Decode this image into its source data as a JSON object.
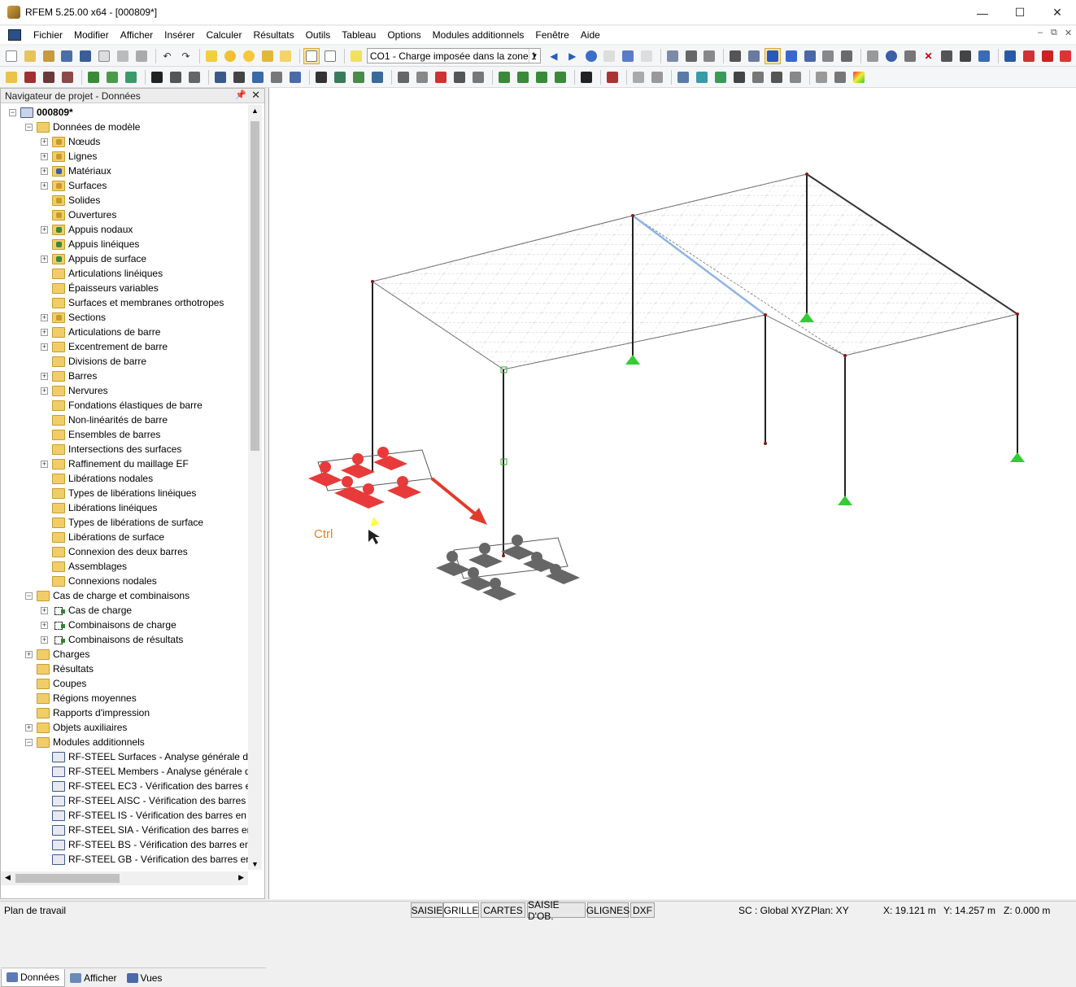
{
  "window": {
    "title": "RFEM 5.25.00 x64 - [000809*]"
  },
  "menu": [
    "Fichier",
    "Modifier",
    "Afficher",
    "Insérer",
    "Calculer",
    "Résultats",
    "Outils",
    "Tableau",
    "Options",
    "Modules additionnels",
    "Fenêtre",
    "Aide"
  ],
  "toolbar": {
    "load_case_combo": "CO1 - Charge imposée dans la zone 1"
  },
  "navigator": {
    "title": "Navigateur de projet - Données",
    "root": "000809*",
    "items": [
      {
        "label": "Données de modèle",
        "level": 1,
        "exp": "-",
        "icon": "folder"
      },
      {
        "label": "Nœuds",
        "level": 2,
        "exp": "+",
        "icon": "node"
      },
      {
        "label": "Lignes",
        "level": 2,
        "exp": "+",
        "icon": "line"
      },
      {
        "label": "Matériaux",
        "level": 2,
        "exp": "+",
        "icon": "mat"
      },
      {
        "label": "Surfaces",
        "level": 2,
        "exp": "+",
        "icon": "surf"
      },
      {
        "label": "Solides",
        "level": 2,
        "exp": "",
        "icon": "solid"
      },
      {
        "label": "Ouvertures",
        "level": 2,
        "exp": "",
        "icon": "open"
      },
      {
        "label": "Appuis nodaux",
        "level": 2,
        "exp": "+",
        "icon": "sup"
      },
      {
        "label": "Appuis linéiques",
        "level": 2,
        "exp": "",
        "icon": "sup"
      },
      {
        "label": "Appuis de surface",
        "level": 2,
        "exp": "+",
        "icon": "sup"
      },
      {
        "label": "Articulations linéiques",
        "level": 2,
        "exp": "",
        "icon": "folder"
      },
      {
        "label": "Épaisseurs variables",
        "level": 2,
        "exp": "",
        "icon": "folder"
      },
      {
        "label": "Surfaces et membranes orthotropes",
        "level": 2,
        "exp": "",
        "icon": "folder"
      },
      {
        "label": "Sections",
        "level": 2,
        "exp": "+",
        "icon": "sec"
      },
      {
        "label": "Articulations de barre",
        "level": 2,
        "exp": "+",
        "icon": "folder"
      },
      {
        "label": "Excentrement de barre",
        "level": 2,
        "exp": "+",
        "icon": "folder"
      },
      {
        "label": "Divisions de barre",
        "level": 2,
        "exp": "",
        "icon": "folder"
      },
      {
        "label": "Barres",
        "level": 2,
        "exp": "+",
        "icon": "folder"
      },
      {
        "label": "Nervures",
        "level": 2,
        "exp": "+",
        "icon": "folder"
      },
      {
        "label": "Fondations élastiques de barre",
        "level": 2,
        "exp": "",
        "icon": "folder"
      },
      {
        "label": "Non-linéarités de barre",
        "level": 2,
        "exp": "",
        "icon": "folder"
      },
      {
        "label": "Ensembles de barres",
        "level": 2,
        "exp": "",
        "icon": "folder"
      },
      {
        "label": "Intersections des surfaces",
        "level": 2,
        "exp": "",
        "icon": "folder"
      },
      {
        "label": "Raffinement du maillage EF",
        "level": 2,
        "exp": "+",
        "icon": "folder"
      },
      {
        "label": "Libérations nodales",
        "level": 2,
        "exp": "",
        "icon": "folder"
      },
      {
        "label": "Types de libérations linéiques",
        "level": 2,
        "exp": "",
        "icon": "folder"
      },
      {
        "label": "Libérations linéiques",
        "level": 2,
        "exp": "",
        "icon": "folder"
      },
      {
        "label": "Types de libérations de surface",
        "level": 2,
        "exp": "",
        "icon": "folder"
      },
      {
        "label": "Libérations de surface",
        "level": 2,
        "exp": "",
        "icon": "folder"
      },
      {
        "label": "Connexion des deux barres",
        "level": 2,
        "exp": "",
        "icon": "folder"
      },
      {
        "label": "Assemblages",
        "level": 2,
        "exp": "",
        "icon": "folder"
      },
      {
        "label": "Connexions nodales",
        "level": 2,
        "exp": "",
        "icon": "folder"
      },
      {
        "label": "Cas de charge et combinaisons",
        "level": 1,
        "exp": "-",
        "icon": "folder"
      },
      {
        "label": "Cas de charge",
        "level": 2,
        "exp": "+",
        "icon": "lc"
      },
      {
        "label": "Combinaisons de charge",
        "level": 2,
        "exp": "+",
        "icon": "lc"
      },
      {
        "label": "Combinaisons de résultats",
        "level": 2,
        "exp": "+",
        "icon": "lc"
      },
      {
        "label": "Charges",
        "level": 1,
        "exp": "+",
        "icon": "folder"
      },
      {
        "label": "Résultats",
        "level": 1,
        "exp": "",
        "icon": "folder"
      },
      {
        "label": "Coupes",
        "level": 1,
        "exp": "",
        "icon": "folder"
      },
      {
        "label": "Régions moyennes",
        "level": 1,
        "exp": "",
        "icon": "folder"
      },
      {
        "label": "Rapports d'impression",
        "level": 1,
        "exp": "",
        "icon": "folder"
      },
      {
        "label": "Objets auxiliaires",
        "level": 1,
        "exp": "+",
        "icon": "folder"
      },
      {
        "label": "Modules additionnels",
        "level": 1,
        "exp": "-",
        "icon": "folder"
      },
      {
        "label": "RF-STEEL Surfaces - Analyse générale des",
        "level": 2,
        "exp": "",
        "icon": "mod"
      },
      {
        "label": "RF-STEEL Members - Analyse générale de",
        "level": 2,
        "exp": "",
        "icon": "mod"
      },
      {
        "label": "RF-STEEL EC3 - Vérification des barres en",
        "level": 2,
        "exp": "",
        "icon": "mod"
      },
      {
        "label": "RF-STEEL AISC - Vérification des barres er",
        "level": 2,
        "exp": "",
        "icon": "mod"
      },
      {
        "label": "RF-STEEL IS - Vérification des barres en ac",
        "level": 2,
        "exp": "",
        "icon": "mod"
      },
      {
        "label": "RF-STEEL SIA - Vérification des barres en a",
        "level": 2,
        "exp": "",
        "icon": "mod"
      },
      {
        "label": "RF-STEEL BS - Vérification des barres en a",
        "level": 2,
        "exp": "",
        "icon": "mod"
      },
      {
        "label": "RF-STEEL GB - Vérification des barres en a",
        "level": 2,
        "exp": "",
        "icon": "mod"
      }
    ],
    "tabs": [
      "Données",
      "Afficher",
      "Vues"
    ]
  },
  "viewport": {
    "ctrl_label": "Ctrl"
  },
  "status": {
    "left": "Plan de travail",
    "buttons": [
      "SAISIE",
      "GRILLE",
      "CARTES",
      "SAISIE D'OB.",
      "GLIGNES",
      "DXF"
    ],
    "active_button": "GRILLE",
    "sc": "SC : Global XYZ",
    "plan": "Plan: XY",
    "x": "X:  19.121 m",
    "y": "Y:  14.257 m",
    "z": "Z:  0.000 m"
  },
  "colors": {
    "support_green": "#33cc33",
    "selected_red": "#e83a3a",
    "arrow_red": "#e03c2c",
    "ghost_gray": "#666666"
  }
}
